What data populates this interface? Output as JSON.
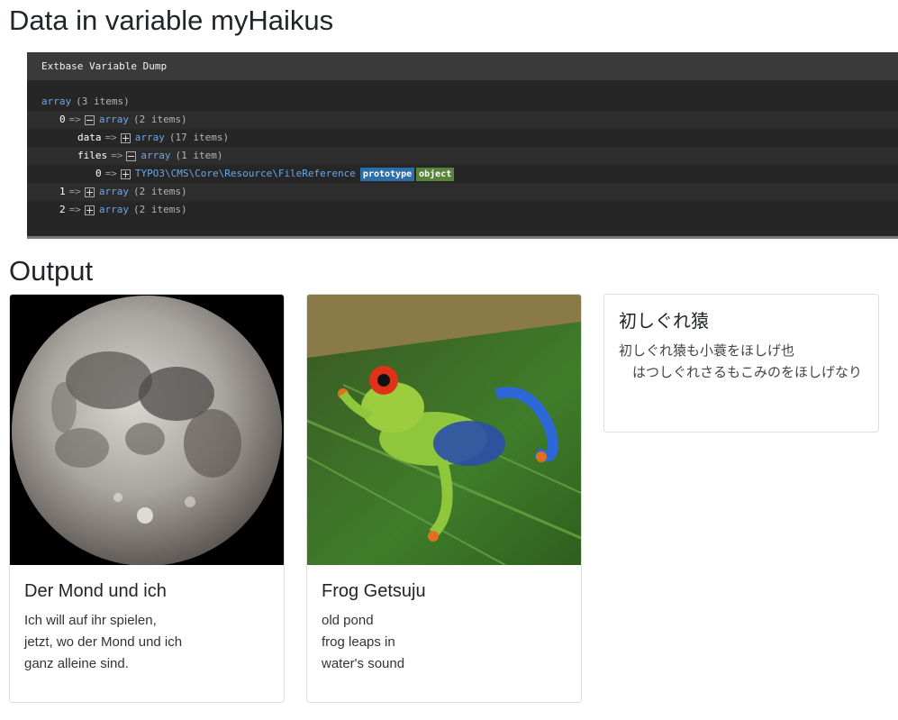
{
  "heading_data": "Data in variable myHaikus",
  "heading_output": "Output",
  "dump": {
    "title": "Extbase Variable Dump",
    "root": {
      "type": "array",
      "count": "(3 items)"
    },
    "item0": {
      "key": "0",
      "arrow": "=>",
      "type": "array",
      "count": "(2 items)"
    },
    "data": {
      "key": "data",
      "arrow": "=>",
      "type": "array",
      "count": "(17 items)"
    },
    "files": {
      "key": "files",
      "arrow": "=>",
      "type": "array",
      "count": "(1 item)"
    },
    "file0": {
      "key": "0",
      "arrow": "=>",
      "type": "TYPO3\\CMS\\Core\\Resource\\FileReference",
      "tag_prototype": "prototype",
      "tag_object": "object"
    },
    "item1": {
      "key": "1",
      "arrow": "=>",
      "type": "array",
      "count": "(2 items)"
    },
    "item2": {
      "key": "2",
      "arrow": "=>",
      "type": "array",
      "count": "(2 items)"
    }
  },
  "cards": [
    {
      "title": "Der Mond und ich",
      "text": "Ich will auf ihr spielen,\njetzt, wo der Mond und ich\nganz alleine sind.",
      "image": "moon-photo"
    },
    {
      "title": "Frog Getsuju",
      "text": "old pond\nfrog leaps in\nwater's sound",
      "image": "tree-frog-photo"
    },
    {
      "title": "初しぐれ猿",
      "text": "初しぐれ猿も小蓑をほしげ也\n　はつしぐれさるもこみのをほしげなり"
    }
  ],
  "colors": {
    "dump_bg": "#262626",
    "dump_header": "#3a3a3a",
    "type_blue": "#6aa6e8",
    "tag_blue": "#2c6ea8",
    "tag_green": "#57843a"
  }
}
